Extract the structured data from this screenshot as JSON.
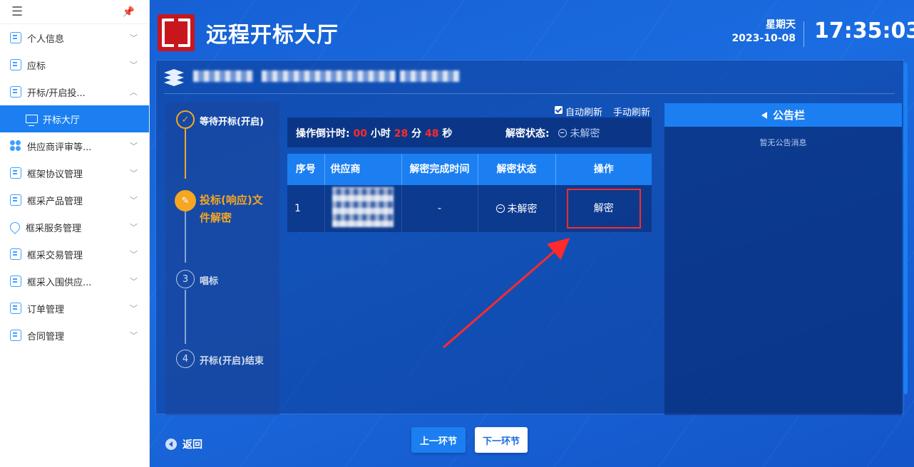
{
  "sidebar": {
    "items": [
      {
        "label": "个人信息",
        "icon": "user-card-icon",
        "chevron": "﹀"
      },
      {
        "label": "应标",
        "icon": "document-icon",
        "chevron": "﹀"
      },
      {
        "label": "开标/开启投...",
        "icon": "document-icon",
        "chevron": "︿"
      },
      {
        "label": "供应商评审等...",
        "icon": "grid-dots-icon",
        "chevron": "﹀"
      },
      {
        "label": "框架协议管理",
        "icon": "document-icon",
        "chevron": "﹀"
      },
      {
        "label": "框采产品管理",
        "icon": "document-icon",
        "chevron": "﹀"
      },
      {
        "label": "框采服务管理",
        "icon": "heart-icon",
        "chevron": "﹀"
      },
      {
        "label": "框采交易管理",
        "icon": "document-icon",
        "chevron": "﹀"
      },
      {
        "label": "框采入围供应...",
        "icon": "document-icon",
        "chevron": "﹀"
      },
      {
        "label": "订单管理",
        "icon": "document-icon",
        "chevron": "﹀"
      },
      {
        "label": "合同管理",
        "icon": "document-icon",
        "chevron": "﹀"
      }
    ],
    "active_sub": "开标大厅"
  },
  "header": {
    "title": "远程开标大厅",
    "weekday": "星期天",
    "date": "2023-10-08",
    "time": "17:35:03"
  },
  "steps": [
    {
      "num": "",
      "label": "等待开标(开启)",
      "state": "done"
    },
    {
      "num": "",
      "label": "投标(响应)文件解密",
      "state": "active"
    },
    {
      "num": "3",
      "label": "唱标",
      "state": "pending"
    },
    {
      "num": "4",
      "label": "开标(开启)结束",
      "state": "pending"
    }
  ],
  "refresh": {
    "auto": "自动刷新",
    "manual": "手动刷新",
    "auto_checked": true
  },
  "countdown": {
    "label": "操作倒计时:",
    "hours": "00",
    "hours_unit": "小时",
    "minutes": "28",
    "minutes_unit": "分",
    "seconds": "48",
    "seconds_unit": "秒",
    "status_label": "解密状态:",
    "status_value": "未解密"
  },
  "table": {
    "headers": [
      "序号",
      "供应商",
      "解密完成时间",
      "解密状态",
      "操作"
    ],
    "rows": [
      {
        "index": "1",
        "complete_time": "-",
        "status": "未解密",
        "action": "解密"
      }
    ]
  },
  "notice": {
    "title": "公告栏",
    "empty": "暂无公告消息"
  },
  "footer": {
    "back": "返回",
    "prev": "上一环节",
    "next": "下一环节"
  },
  "colors": {
    "primary": "#1b7ff2",
    "highlight_red": "#ff2a2a",
    "step_active": "#f5a623"
  }
}
